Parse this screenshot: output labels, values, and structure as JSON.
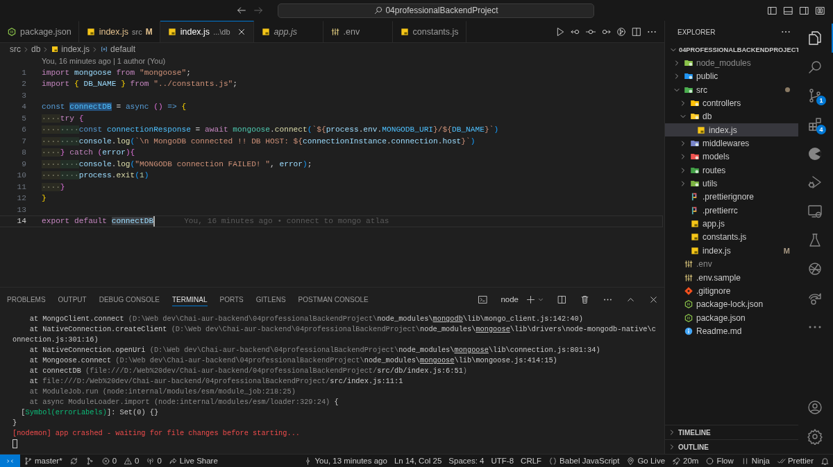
{
  "title_bar": {
    "search": "04professionalBackendProject"
  },
  "tabs": [
    {
      "label": "package.json",
      "kind": "json",
      "modified": false,
      "preview": false,
      "selected": false
    },
    {
      "label": "index.js",
      "kind": "js",
      "detail": "src",
      "badge": "M",
      "modified": true,
      "preview": false,
      "selected": false
    },
    {
      "label": "index.js",
      "kind": "js",
      "detail": "...\\db",
      "modified": false,
      "preview": false,
      "selected": true
    },
    {
      "label": "app.js",
      "kind": "js",
      "modified": false,
      "preview": true,
      "selected": false
    },
    {
      "label": ".env",
      "kind": "env",
      "modified": false,
      "preview": false,
      "selected": false
    },
    {
      "label": "constants.js",
      "kind": "js",
      "modified": false,
      "preview": false,
      "selected": false
    }
  ],
  "breadcrumbs": [
    {
      "label": "src",
      "kind": "folder"
    },
    {
      "label": "db",
      "kind": "folder"
    },
    {
      "label": "index.js",
      "kind": "js"
    },
    {
      "label": "default",
      "kind": "symbol"
    }
  ],
  "editor": {
    "blame_header": "You, 16 minutes ago | 1 author (You)",
    "lines": [
      {
        "number": "1",
        "current": false,
        "cursor": false,
        "tokens": [
          {
            "text": "import ",
            "kind": "kw"
          },
          {
            "text": "mongoose ",
            "kind": "var"
          },
          {
            "text": "from ",
            "kind": "kw"
          },
          {
            "text": "\"mongoose\"",
            "kind": "str"
          },
          {
            "text": ";",
            "kind": "p"
          }
        ]
      },
      {
        "number": "2",
        "current": false,
        "cursor": false,
        "tokens": [
          {
            "text": "import ",
            "kind": "kw"
          },
          {
            "text": "{",
            "kind": "b1"
          },
          {
            "text": " DB_NAME ",
            "kind": "var"
          },
          {
            "text": "} ",
            "kind": "b1"
          },
          {
            "text": "from ",
            "kind": "kw"
          },
          {
            "text": "\"../constants.js\"",
            "kind": "str"
          },
          {
            "text": ";",
            "kind": "p"
          }
        ]
      },
      {
        "number": "3",
        "current": false,
        "cursor": false
      },
      {
        "number": "4",
        "current": false,
        "cursor": false,
        "tokens": [
          {
            "text": "const ",
            "kind": "st"
          },
          {
            "text": "connectDB",
            "kind": "hl"
          },
          {
            "text": " = ",
            "kind": "p"
          },
          {
            "text": "async ",
            "kind": "st"
          },
          {
            "text": "() ",
            "kind": "b2"
          },
          {
            "text": "=> ",
            "kind": "st"
          },
          {
            "text": "{",
            "kind": "b1"
          }
        ]
      },
      {
        "number": "5",
        "current": false,
        "cursor": false,
        "tokens": [
          {
            "text": "····",
            "kind": "ws1"
          },
          {
            "text": "try ",
            "kind": "kw"
          },
          {
            "text": "{",
            "kind": "b2"
          }
        ]
      },
      {
        "number": "6",
        "current": false,
        "cursor": false,
        "tokens": [
          {
            "text": "····",
            "kind": "ws1"
          },
          {
            "text": "····",
            "kind": "ws2"
          },
          {
            "text": "const ",
            "kind": "st"
          },
          {
            "text": "connectionResponse",
            "kind": "const"
          },
          {
            "text": " = ",
            "kind": "p"
          },
          {
            "text": "await ",
            "kind": "kw"
          },
          {
            "text": "mongoose",
            "kind": "mod"
          },
          {
            "text": ".",
            "kind": "p"
          },
          {
            "text": "connect",
            "kind": "fn"
          },
          {
            "text": "(",
            "kind": "b3"
          },
          {
            "text": "`${",
            "kind": "str"
          },
          {
            "text": "process",
            "kind": "var"
          },
          {
            "text": ".",
            "kind": "p"
          },
          {
            "text": "env",
            "kind": "var"
          },
          {
            "text": ".",
            "kind": "p"
          },
          {
            "text": "MONGODB_URI",
            "kind": "const"
          },
          {
            "text": "}/${",
            "kind": "str"
          },
          {
            "text": "DB_NAME",
            "kind": "const"
          },
          {
            "text": "}`",
            "kind": "str"
          },
          {
            "text": ")",
            "kind": "b3"
          }
        ]
      },
      {
        "number": "7",
        "current": false,
        "cursor": false,
        "tokens": [
          {
            "text": "····",
            "kind": "ws1"
          },
          {
            "text": "····",
            "kind": "ws2"
          },
          {
            "text": "console",
            "kind": "var"
          },
          {
            "text": ".",
            "kind": "p"
          },
          {
            "text": "log",
            "kind": "fn"
          },
          {
            "text": "(",
            "kind": "b3"
          },
          {
            "text": "`\\n MongoDB connected !! DB HOST: ${",
            "kind": "str"
          },
          {
            "text": "connectionInstance",
            "kind": "var"
          },
          {
            "text": ".",
            "kind": "p"
          },
          {
            "text": "connection",
            "kind": "var"
          },
          {
            "text": ".",
            "kind": "p"
          },
          {
            "text": "host",
            "kind": "var"
          },
          {
            "text": "}`",
            "kind": "str"
          },
          {
            "text": ")",
            "kind": "b3"
          }
        ]
      },
      {
        "number": "8",
        "current": false,
        "cursor": false,
        "tokens": [
          {
            "text": "····",
            "kind": "ws1"
          },
          {
            "text": "} ",
            "kind": "b2"
          },
          {
            "text": "catch ",
            "kind": "kw"
          },
          {
            "text": "(",
            "kind": "b2"
          },
          {
            "text": "error",
            "kind": "var"
          },
          {
            "text": ")",
            "kind": "b2"
          },
          {
            "text": "{",
            "kind": "b2"
          }
        ]
      },
      {
        "number": "9",
        "current": false,
        "cursor": false,
        "tokens": [
          {
            "text": "····",
            "kind": "ws1"
          },
          {
            "text": "····",
            "kind": "ws2"
          },
          {
            "text": "console",
            "kind": "var"
          },
          {
            "text": ".",
            "kind": "p"
          },
          {
            "text": "log",
            "kind": "fn"
          },
          {
            "text": "(",
            "kind": "b3"
          },
          {
            "text": "\"MONGODB connection FAILED! \"",
            "kind": "str"
          },
          {
            "text": ", ",
            "kind": "p"
          },
          {
            "text": "error",
            "kind": "var"
          },
          {
            "text": ")",
            "kind": "b3"
          },
          {
            "text": ";",
            "kind": "p"
          }
        ]
      },
      {
        "number": "10",
        "current": false,
        "cursor": false,
        "tokens": [
          {
            "text": "····",
            "kind": "ws1"
          },
          {
            "text": "····",
            "kind": "ws2"
          },
          {
            "text": "process",
            "kind": "var"
          },
          {
            "text": ".",
            "kind": "p"
          },
          {
            "text": "exit",
            "kind": "fn"
          },
          {
            "text": "(",
            "kind": "b3"
          },
          {
            "text": "1",
            "kind": "num"
          },
          {
            "text": ")",
            "kind": "b3"
          }
        ]
      },
      {
        "number": "11",
        "current": false,
        "cursor": false,
        "tokens": [
          {
            "text": "····",
            "kind": "ws1"
          },
          {
            "text": "}",
            "kind": "b2"
          }
        ]
      },
      {
        "number": "12",
        "current": false,
        "cursor": false,
        "tokens": [
          {
            "text": "}",
            "kind": "b1"
          }
        ]
      },
      {
        "number": "13",
        "current": false,
        "cursor": false
      },
      {
        "number": "14",
        "current": true,
        "cursor": true,
        "blame": "You, 16 minutes ago • connect to mongo atlas",
        "tokens": [
          {
            "text": "export ",
            "kind": "kw"
          },
          {
            "text": "default ",
            "kind": "kw"
          },
          {
            "text": "connectDB",
            "kind": "hl2"
          }
        ]
      }
    ]
  },
  "panel": {
    "tabs": [
      {
        "label": "PROBLEMS",
        "selected": false
      },
      {
        "label": "OUTPUT",
        "selected": false
      },
      {
        "label": "DEBUG CONSOLE",
        "selected": false
      },
      {
        "label": "TERMINAL",
        "selected": true
      },
      {
        "label": "PORTS",
        "selected": false
      },
      {
        "label": "GITLENS",
        "selected": false
      },
      {
        "label": "POSTMAN CONSOLE",
        "selected": false
      }
    ],
    "terminal_name": "node",
    "cursor": true,
    "lines": [
      [
        {
          "text": "    at MongoClient.connect ",
          "kind": "p"
        },
        {
          "text": "(D:\\Web dev\\Chai-aur-backend\\04professionalBackendProject\\",
          "kind": "dim"
        },
        {
          "text": "node_modules\\",
          "kind": "p"
        },
        {
          "text": "mongodb",
          "kind": "ul"
        },
        {
          "text": "\\lib\\mongo_client.js:142:40)",
          "kind": "p"
        }
      ],
      [
        {
          "text": "    at NativeConnection.createClient ",
          "kind": "p"
        },
        {
          "text": "(D:\\Web dev\\Chai-aur-backend\\04professionalBackendProject\\",
          "kind": "dim"
        },
        {
          "text": "node_modules\\",
          "kind": "p"
        },
        {
          "text": "mongoose",
          "kind": "ul"
        },
        {
          "text": "\\lib\\drivers\\node-mongodb-native\\c",
          "kind": "p"
        }
      ],
      [
        {
          "text": "onnection.js:301:16)",
          "kind": "p"
        }
      ],
      [
        {
          "text": "    at NativeConnection.openUri ",
          "kind": "p"
        },
        {
          "text": "(D:\\Web dev\\Chai-aur-backend\\04professionalBackendProject\\",
          "kind": "dim"
        },
        {
          "text": "node_modules\\",
          "kind": "p"
        },
        {
          "text": "mongoose",
          "kind": "ul"
        },
        {
          "text": "\\lib\\connection.js:801:34)",
          "kind": "p"
        }
      ],
      [
        {
          "text": "    at Mongoose.connect ",
          "kind": "p"
        },
        {
          "text": "(D:\\Web dev\\Chai-aur-backend\\04professionalBackendProject\\",
          "kind": "dim"
        },
        {
          "text": "node_modules\\",
          "kind": "p"
        },
        {
          "text": "mongoose",
          "kind": "ul"
        },
        {
          "text": "\\lib\\mongoose.js:414:15)",
          "kind": "p"
        }
      ],
      [
        {
          "text": "    at connectDB ",
          "kind": "p"
        },
        {
          "text": "(file:///D:/Web%20dev/Chai-aur-backend/04professionalBackendProject/",
          "kind": "dim"
        },
        {
          "text": "src/db/index.js:6:51",
          "kind": "p"
        },
        {
          "text": ")",
          "kind": "dim"
        }
      ],
      [
        {
          "text": "    at ",
          "kind": "p"
        },
        {
          "text": "file:///D:/Web%20dev/Chai-aur-backend/04professionalBackendProject/",
          "kind": "dim"
        },
        {
          "text": "src/index.js:11:1",
          "kind": "p"
        }
      ],
      [
        {
          "text": "    at ModuleJob.run (node:internal/modules/esm/module_job:218:25)",
          "kind": "dim"
        }
      ],
      [
        {
          "text": "    at async ModuleLoader.import (node:internal/modules/esm/loader:329:24)",
          "kind": "dim"
        },
        {
          "text": " {",
          "kind": "p"
        }
      ],
      [
        {
          "text": "  [",
          "kind": "p"
        },
        {
          "text": "Symbol(errorLabels)",
          "kind": "green"
        },
        {
          "text": "]: Set(0) {}",
          "kind": "p"
        }
      ],
      [
        {
          "text": "}",
          "kind": "p"
        }
      ],
      [
        {
          "text": "[nodemon] app crashed - waiting for file changes before starting...",
          "kind": "red"
        }
      ]
    ]
  },
  "explorer": {
    "title": "EXPLORER",
    "root": "04PROFESSIONALBACKENDPROJECT",
    "root_expanded": true,
    "items": [
      {
        "label": "node_modules",
        "kind": "folder-node",
        "expanded": false,
        "dimmed": true,
        "modified": false,
        "selected": false
      },
      {
        "label": "public",
        "kind": "folder-public",
        "expanded": false,
        "dimmed": false,
        "modified": false,
        "selected": false
      },
      {
        "label": "src",
        "kind": "folder-src",
        "expanded": true,
        "dimmed": false,
        "modified": true,
        "selected": false,
        "children": [
          {
            "label": "controllers",
            "kind": "folder-controller",
            "expanded": false,
            "dimmed": false,
            "modified": false,
            "selected": false
          },
          {
            "label": "db",
            "kind": "folder-db",
            "expanded": true,
            "dimmed": false,
            "modified": false,
            "selected": false,
            "children": [
              {
                "label": "index.js",
                "kind": "js",
                "dimmed": false,
                "modified": false,
                "selected": true
              }
            ]
          },
          {
            "label": "middlewares",
            "kind": "folder-middleware",
            "expanded": false,
            "dimmed": false,
            "modified": false,
            "selected": false
          },
          {
            "label": "models",
            "kind": "folder-models",
            "expanded": false,
            "dimmed": false,
            "modified": false,
            "selected": false
          },
          {
            "label": "routes",
            "kind": "folder-routes",
            "expanded": false,
            "dimmed": false,
            "modified": false,
            "selected": false
          },
          {
            "label": "utils",
            "kind": "folder-utils",
            "expanded": false,
            "dimmed": false,
            "modified": false,
            "selected": false
          },
          {
            "label": ".prettierignore",
            "kind": "prettier",
            "dimmed": false,
            "modified": false,
            "selected": false
          },
          {
            "label": ".prettierrc",
            "kind": "prettier",
            "dimmed": false,
            "modified": false,
            "selected": false
          },
          {
            "label": "app.js",
            "kind": "js",
            "dimmed": false,
            "modified": false,
            "selected": false
          },
          {
            "label": "constants.js",
            "kind": "js",
            "dimmed": false,
            "modified": false,
            "selected": false
          },
          {
            "label": "index.js",
            "kind": "js",
            "dimmed": false,
            "modified": false,
            "selected": false,
            "badge": "M"
          }
        ]
      },
      {
        "label": ".env",
        "kind": "env",
        "dimmed": true,
        "modified": false,
        "selected": false
      },
      {
        "label": ".env.sample",
        "kind": "env",
        "dimmed": false,
        "modified": false,
        "selected": false
      },
      {
        "label": ".gitignore",
        "kind": "git",
        "dimmed": false,
        "modified": false,
        "selected": false
      },
      {
        "label": "package-lock.json",
        "kind": "json",
        "dimmed": false,
        "modified": false,
        "selected": false
      },
      {
        "label": "package.json",
        "kind": "json",
        "dimmed": false,
        "modified": false,
        "selected": false
      },
      {
        "label": "Readme.md",
        "kind": "info",
        "dimmed": false,
        "modified": false,
        "selected": false
      }
    ],
    "sections": [
      {
        "label": "TIMELINE",
        "expanded": false
      },
      {
        "label": "OUTLINE",
        "expanded": false
      }
    ]
  },
  "activity_bar": {
    "top": [
      {
        "kind": "files",
        "selected": true
      },
      {
        "kind": "search",
        "selected": false
      },
      {
        "kind": "scm",
        "selected": false,
        "badge": "1"
      },
      {
        "kind": "extensions",
        "selected": false,
        "badge": "4"
      },
      {
        "kind": "pie",
        "selected": false
      },
      {
        "kind": "debug",
        "selected": false
      },
      {
        "kind": "remote",
        "selected": false
      },
      {
        "kind": "flask",
        "selected": false
      },
      {
        "kind": "ball",
        "selected": false
      },
      {
        "kind": "share",
        "selected": false
      },
      {
        "kind": "more",
        "selected": false
      }
    ],
    "bottom": [
      {
        "kind": "account",
        "selected": false
      },
      {
        "kind": "gear",
        "selected": false
      }
    ]
  },
  "status_bar": {
    "left": [
      {
        "kind": "remote-x"
      },
      {
        "kind": "branch",
        "text": "master*"
      },
      {
        "kind": "sync"
      },
      {
        "kind": "graph"
      },
      {
        "kind": "error",
        "text": "0"
      },
      {
        "kind": "warning",
        "text": "0"
      },
      {
        "kind": "broadcast",
        "text": "0"
      },
      {
        "kind": "liveshare",
        "text": "Live Share"
      }
    ],
    "right": [
      {
        "kind": "commit",
        "text": "You, 13 minutes ago"
      },
      {
        "kind": "plain",
        "text": "Ln 14, Col 25"
      },
      {
        "kind": "plain",
        "text": "Spaces: 4"
      },
      {
        "kind": "plain",
        "text": "UTF-8"
      },
      {
        "kind": "plain",
        "text": "CRLF"
      },
      {
        "kind": "braces",
        "text": "Babel JavaScript"
      },
      {
        "kind": "golive",
        "text": "Go Live"
      },
      {
        "kind": "rocket",
        "text": "20m"
      },
      {
        "kind": "circle",
        "text": "Flow"
      },
      {
        "kind": "pause",
        "text": "Ninja"
      },
      {
        "kind": "checks",
        "text": "Prettier"
      },
      {
        "kind": "bell"
      }
    ]
  }
}
